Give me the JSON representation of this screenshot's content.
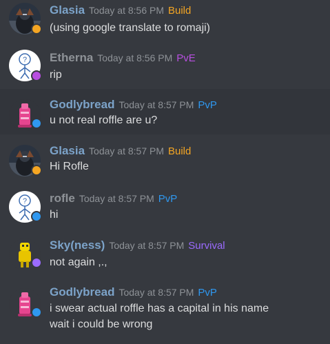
{
  "colors": {
    "background": "#36393f",
    "hover_background": "#32353b",
    "author_default": "#7ca3c9",
    "author_grey": "#8e9297",
    "build_role": "#f5a623",
    "pve_role": "#b84fe0",
    "pvp_role": "#2f98f0",
    "survival_role": "#9b6bff"
  },
  "messages": [
    {
      "author": "Glasia",
      "timestamp": "Today at 8:56 PM",
      "role": "Build",
      "status_color": "#f5a623",
      "avatar_icon": "dark-armor-avatar-icon",
      "lines": [
        "(using google translate to romaji)"
      ]
    },
    {
      "author": "Etherna",
      "timestamp": "Today at 8:56 PM",
      "role": "PvE",
      "status_color": "#b84fe0",
      "avatar_icon": "question-stickman-avatar-icon",
      "lines": [
        "rip"
      ]
    },
    {
      "author": "Godlybread",
      "timestamp": "Today at 8:57 PM",
      "role": "PvP",
      "status_color": "#2f98f0",
      "avatar_icon": "pink-tower-avatar-icon",
      "lines": [
        "u not real roffle are u?"
      ]
    },
    {
      "author": "Glasia",
      "timestamp": "Today at 8:57 PM",
      "role": "Build",
      "status_color": "#f5a623",
      "avatar_icon": "dark-armor-avatar-icon",
      "lines": [
        "Hi Rofle"
      ]
    },
    {
      "author": "rofle",
      "timestamp": "Today at 8:57 PM",
      "role": "PvP",
      "status_color": "#2f98f0",
      "avatar_icon": "question-stickman-avatar-icon",
      "lines": [
        "hi"
      ]
    },
    {
      "author": "Sky(ness)",
      "timestamp": "Today at 8:57 PM",
      "role": "Survival",
      "status_color": "#9b6bff",
      "avatar_icon": "yellow-robot-avatar-icon",
      "lines": [
        "not again ,.,"
      ]
    },
    {
      "author": "Godlybread",
      "timestamp": "Today at 8:57 PM",
      "role": "PvP",
      "status_color": "#2f98f0",
      "avatar_icon": "pink-tower-avatar-icon",
      "lines": [
        "i swear actual roffle has a capital in his name",
        "wait i could be wrong"
      ]
    }
  ]
}
